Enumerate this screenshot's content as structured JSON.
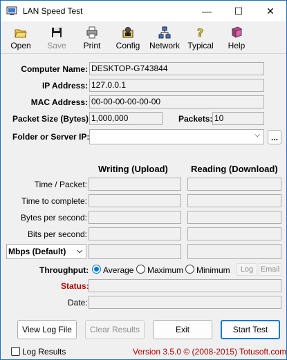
{
  "window": {
    "title": "LAN Speed Test",
    "minimize": "—",
    "maximize": "☐",
    "close": "✕"
  },
  "toolbar": {
    "open": "Open",
    "save": "Save",
    "print": "Print",
    "config": "Config",
    "network": "Network",
    "typical": "Typical",
    "help": "Help"
  },
  "info": {
    "computer_name_label": "Computer Name:",
    "computer_name": "DESKTOP-G743844",
    "ip_label": "IP Address:",
    "ip": "127.0.0.1",
    "mac_label": "MAC Address:",
    "mac": "00-00-00-00-00-00",
    "packet_size_label": "Packet Size (Bytes):",
    "packet_size": "1,000,000",
    "packets_label": "Packets:",
    "packets": "10",
    "folder_label": "Folder or Server IP:",
    "folder_value": "",
    "browse": "..."
  },
  "results": {
    "writing_header": "Writing (Upload)",
    "reading_header": "Reading (Download)",
    "time_packet": "Time / Packet:",
    "time_complete": "Time to complete:",
    "bytes_sec": "Bytes per second:",
    "bits_sec": "Bits per second:",
    "units_select": "Mbps (Default)"
  },
  "throughput": {
    "label": "Throughput:",
    "average": "Average",
    "maximum": "Maximum",
    "minimum": "Minimum",
    "selected": "average",
    "log": "Log",
    "email": "Email"
  },
  "status": {
    "label": "Status:",
    "date_label": "Date:",
    "label_color": "#b00000"
  },
  "buttons": {
    "view_log": "View Log File",
    "clear": "Clear Results",
    "exit": "Exit",
    "start": "Start Test"
  },
  "footer": {
    "log_results": "Log Results",
    "version": "Version 3.5.0  © (2008-2015) Totusoft.com",
    "version_color": "#b00000"
  }
}
